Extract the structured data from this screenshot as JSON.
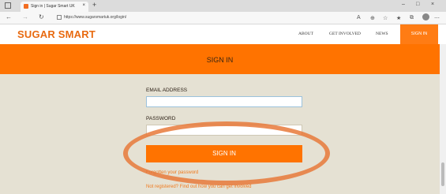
{
  "browser": {
    "tab_title": "Sign in | Sugar Smart UK",
    "tab_close": "×",
    "new_tab": "+",
    "url": "https://www.sugarsmartuk.org/login/",
    "window_min": "–",
    "window_max": "□",
    "window_close": "×"
  },
  "site": {
    "logo": "SUGAR SMART",
    "nav": [
      "ABOUT",
      "GET INVOLVED",
      "NEWS"
    ],
    "signin_tab": "SIGN IN"
  },
  "banner": {
    "title": "SIGN IN"
  },
  "form": {
    "email_label": "EMAIL ADDRESS",
    "email_value": "",
    "password_label": "PASSWORD",
    "password_value": "",
    "submit": "SIGN IN",
    "forgot_link": "Forgotten your password",
    "register_link": "Not registered? Find out how you can get involved"
  },
  "colors": {
    "brand": "#ff7300",
    "annotation": "#e8793a",
    "background": "#e5e1d3"
  }
}
